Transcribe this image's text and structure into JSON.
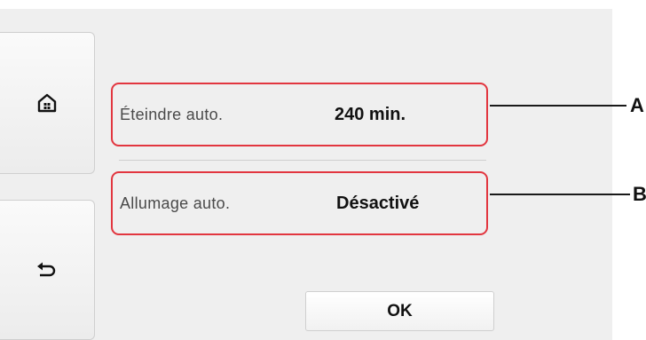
{
  "sidebar": {
    "home_icon": "home-icon",
    "back_icon": "back-arrow-icon"
  },
  "settings": [
    {
      "label": "Éteindre auto.",
      "value": "240 min."
    },
    {
      "label": "Allumage auto.",
      "value": "Désactivé"
    }
  ],
  "buttons": {
    "ok_label": "OK"
  },
  "callouts": {
    "a": "A",
    "b": "B"
  },
  "colors": {
    "highlight": "#e2363f",
    "screen_bg": "#efefef"
  }
}
